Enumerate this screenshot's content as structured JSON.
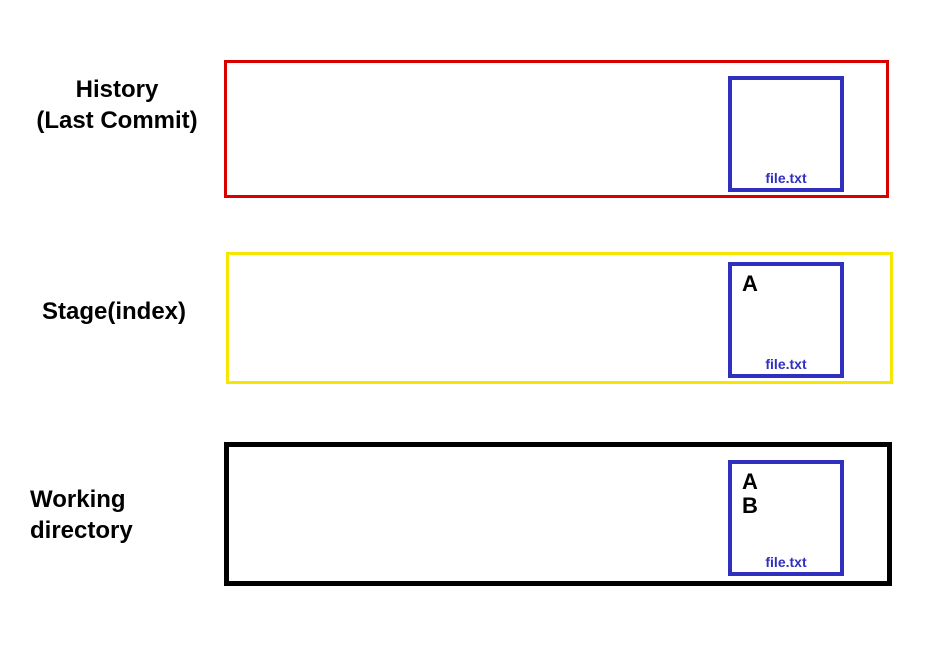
{
  "areas": {
    "history": {
      "label_line1": "History",
      "label_line2": "(Last Commit)",
      "border_color": "#d90000",
      "file": {
        "name": "file.txt",
        "content": ""
      }
    },
    "stage": {
      "label": "Stage(index)",
      "border_color": "#f7e600",
      "file": {
        "name": "file.txt",
        "content": "A"
      }
    },
    "working": {
      "label_line1": "Working",
      "label_line2": "directory",
      "border_color": "#000000",
      "file": {
        "name": "file.txt",
        "content_line1": "A",
        "content_line2": "B"
      }
    }
  },
  "colors": {
    "file_box_border": "#3030c0",
    "file_label_color": "#3030c0"
  }
}
